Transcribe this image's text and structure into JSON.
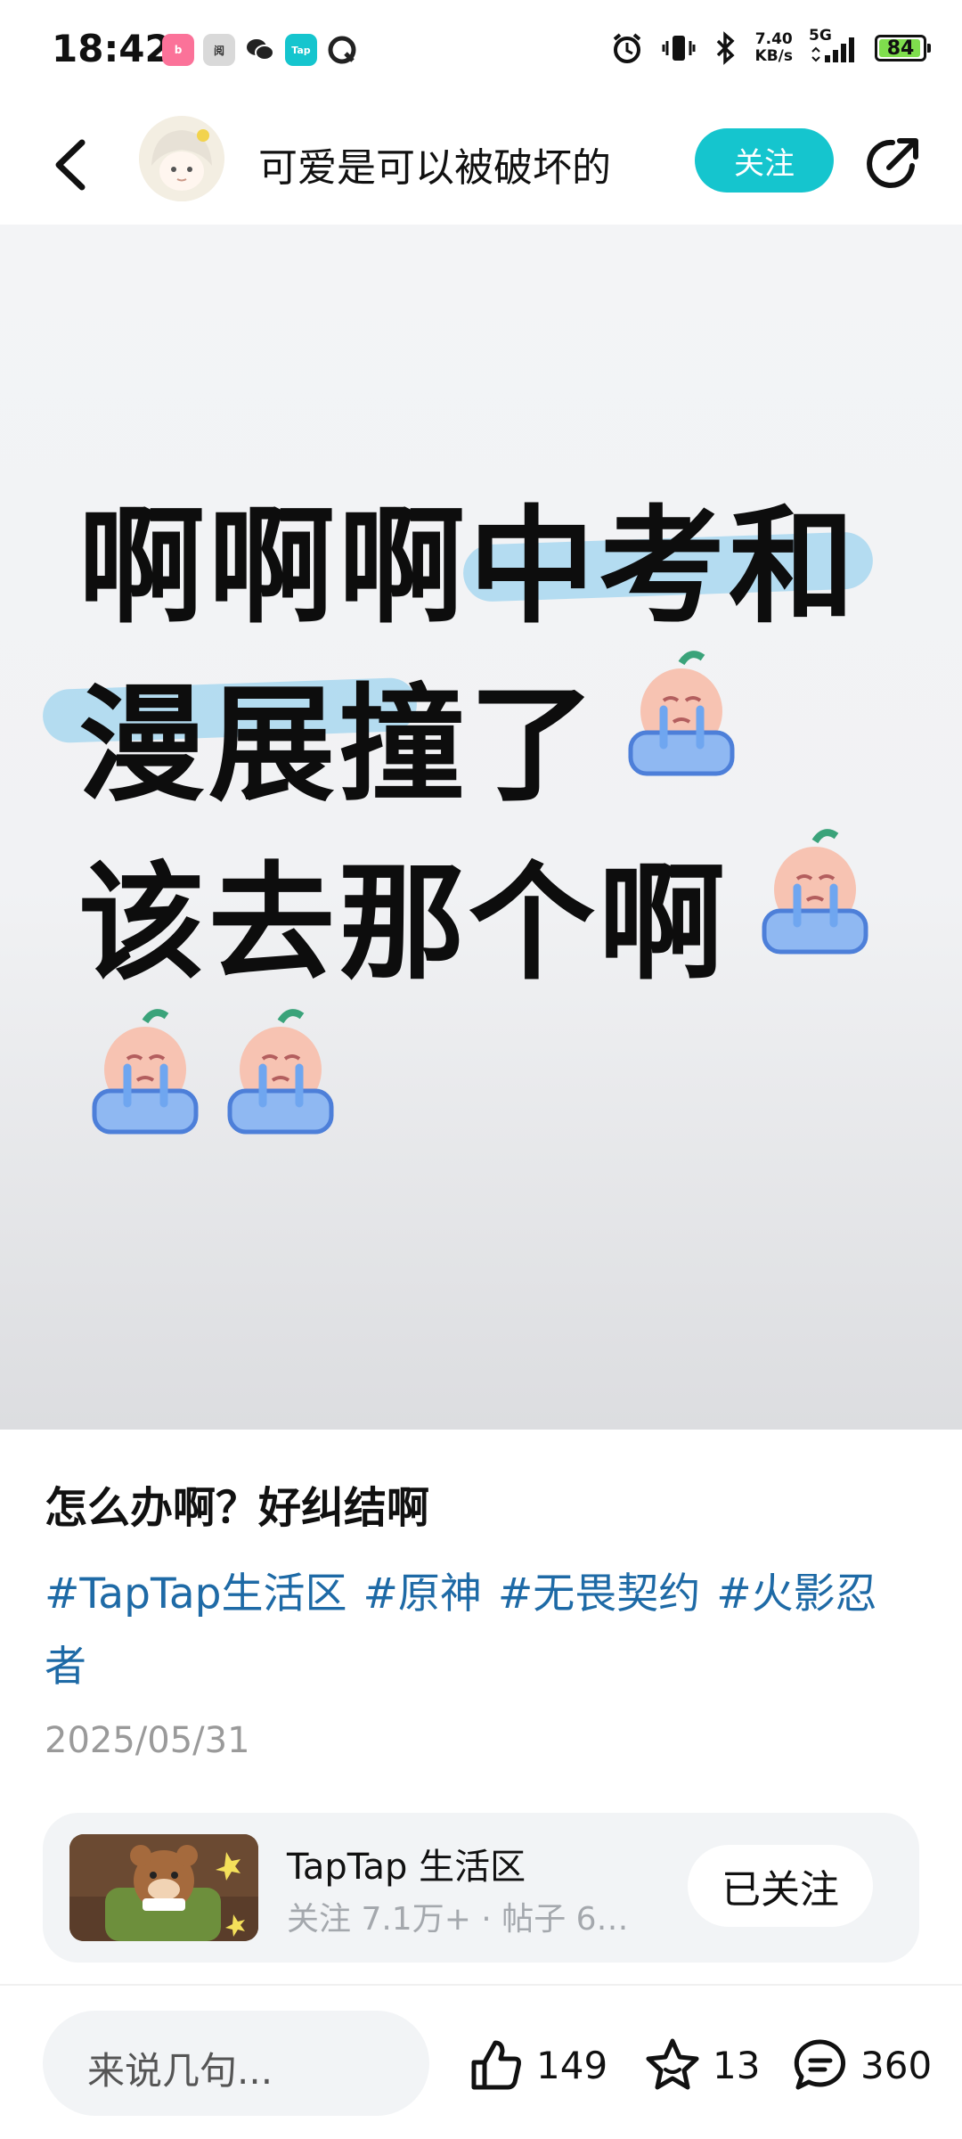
{
  "status_bar": {
    "time": "18:42",
    "apps": [
      "bilibili-icon",
      "reader-icon",
      "wechat-icon",
      "taptap-icon",
      "qq-icon"
    ],
    "net_speed_value": "7.40",
    "net_speed_unit": "KB/s",
    "network": "5G",
    "battery": "84"
  },
  "header": {
    "author_name": "可爱是可以被破坏的",
    "follow_label": "关注"
  },
  "post_image": {
    "lines": [
      "啊啊啊中考和",
      "漫展撞了",
      "该去那个啊"
    ]
  },
  "post": {
    "title": "怎么办啊？好纠结啊",
    "tags": [
      "#TapTap生活区",
      "#原神",
      "#无畏契约",
      "#火影忍者"
    ],
    "date": "2025/05/31"
  },
  "group": {
    "name": "TapTap 生活区",
    "stats": "关注 7.1万+ · 帖子 6…",
    "followed_label": "已关注"
  },
  "bottom_bar": {
    "comment_placeholder": "来说几句...",
    "likes": "149",
    "favorites": "13",
    "comments": "360"
  },
  "colors": {
    "accent": "#15c5ce",
    "tag": "#1e6aa6",
    "battery_fill": "#7fde4d"
  }
}
